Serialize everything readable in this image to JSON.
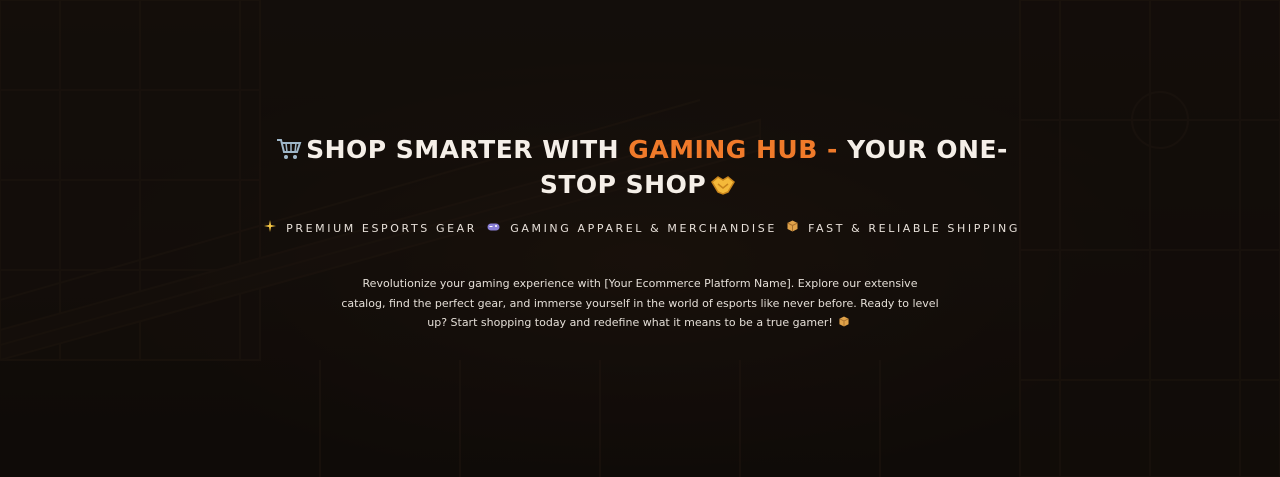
{
  "hero": {
    "headline": {
      "prefix_icon": "shopping-cart-icon",
      "part1": "SHOP SMARTER WITH ",
      "brand": "GAMING HUB - ",
      "part2": "YOUR ONE-STOP SHOP",
      "suffix_icon": "handshake-icon",
      "accent_color": "#f07a2a"
    },
    "features": [
      {
        "icon": "sparkles-icon",
        "label": "PREMIUM ESPORTS GEAR"
      },
      {
        "icon": "game-controller-icon",
        "label": "GAMING APPAREL & MERCHANDISE"
      },
      {
        "icon": "package-icon",
        "label": "FAST & RELIABLE SHIPPING"
      }
    ],
    "description": "Revolutionize your gaming experience with [Your Ecommerce Platform Name]. Explore our extensive catalog, find the perfect gear, and immerse yourself in the world of esports like never before. Ready to level up? Start shopping today and redefine what it means to be a true gamer!",
    "description_icon": "package-icon"
  }
}
